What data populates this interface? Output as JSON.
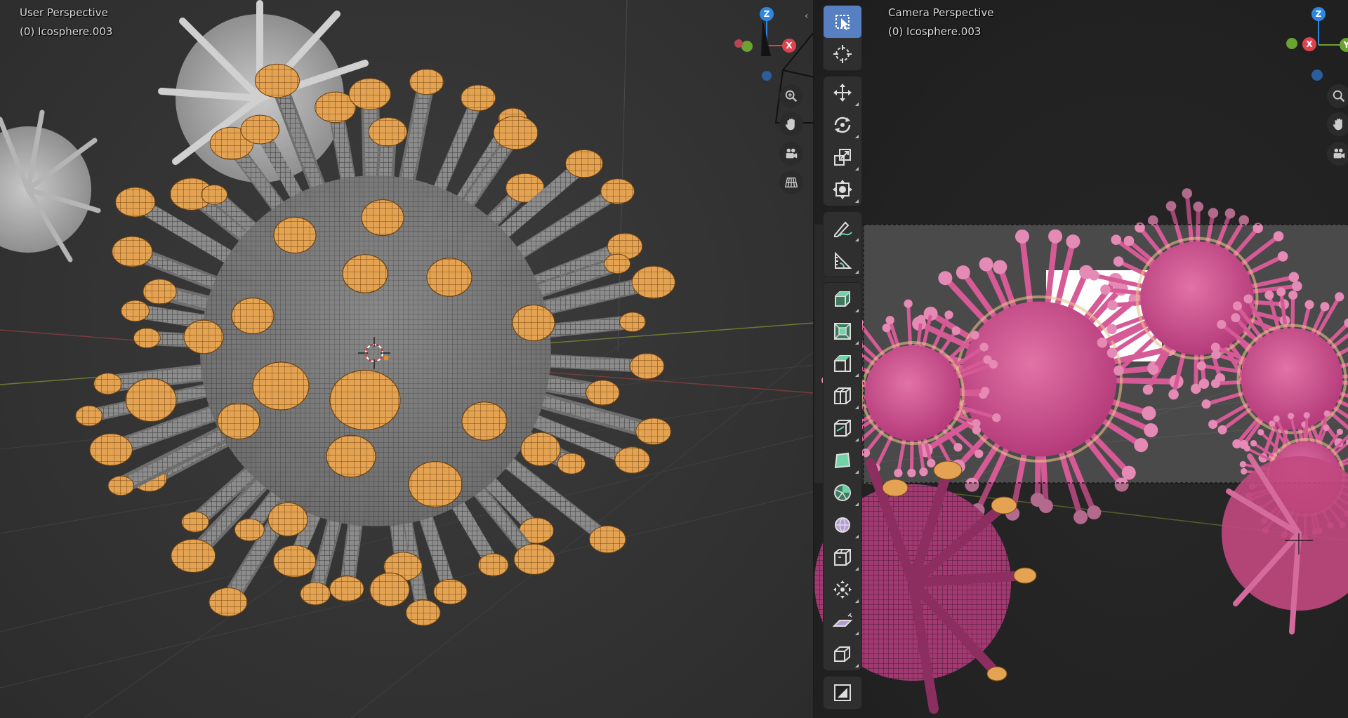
{
  "left_viewport": {
    "title": "User Perspective",
    "object": "(0) Icosphere.003"
  },
  "right_viewport": {
    "title": "Camera Perspective",
    "object": "(0) Icosphere.003"
  },
  "gizmo_labels": {
    "z": "Z",
    "x": "X",
    "y": "Y"
  },
  "toolbar": {
    "tools": [
      {
        "name": "select-box-tool",
        "icon": "select-box-icon",
        "group": 0,
        "active": true
      },
      {
        "name": "cursor-tool",
        "icon": "cursor-icon",
        "group": 0
      },
      {
        "name": "move-tool",
        "icon": "move-icon",
        "group": 1
      },
      {
        "name": "rotate-tool",
        "icon": "rotate-icon",
        "group": 1
      },
      {
        "name": "scale-tool",
        "icon": "scale-icon",
        "group": 1
      },
      {
        "name": "transform-tool",
        "icon": "transform-icon",
        "group": 1
      },
      {
        "name": "annotate-tool",
        "icon": "annotate-icon",
        "group": 2
      },
      {
        "name": "measure-tool",
        "icon": "measure-icon",
        "group": 2
      },
      {
        "name": "extrude-region-tool",
        "icon": "extrude-icon",
        "group": 3
      },
      {
        "name": "inset-faces-tool",
        "icon": "inset-icon",
        "group": 3
      },
      {
        "name": "bevel-tool",
        "icon": "bevel-icon",
        "group": 3
      },
      {
        "name": "loop-cut-tool",
        "icon": "loop-cut-icon",
        "group": 3
      },
      {
        "name": "knife-tool",
        "icon": "knife-icon",
        "group": 3
      },
      {
        "name": "poly-build-tool",
        "icon": "poly-build-icon",
        "group": 3
      },
      {
        "name": "spin-tool",
        "icon": "spin-icon",
        "group": 3
      },
      {
        "name": "smooth-tool",
        "icon": "smooth-icon",
        "group": 3
      },
      {
        "name": "edge-slide-tool",
        "icon": "edge-slide-icon",
        "group": 3
      },
      {
        "name": "shrink-fatten-tool",
        "icon": "shrink-fatten-icon",
        "group": 3
      },
      {
        "name": "shear-tool",
        "icon": "shear-icon",
        "group": 3
      },
      {
        "name": "rip-region-tool",
        "icon": "rip-icon",
        "group": 3
      },
      {
        "name": "add-cube-tool",
        "icon": "add-cube-icon",
        "group": 4
      }
    ]
  },
  "colors": {
    "accent": "#5680c2",
    "axis_x": "#e0414f",
    "axis_y": "#6aa331",
    "axis_z": "#2f86e0",
    "selection": "#e3a352",
    "virus_render": "#d14d8c"
  }
}
